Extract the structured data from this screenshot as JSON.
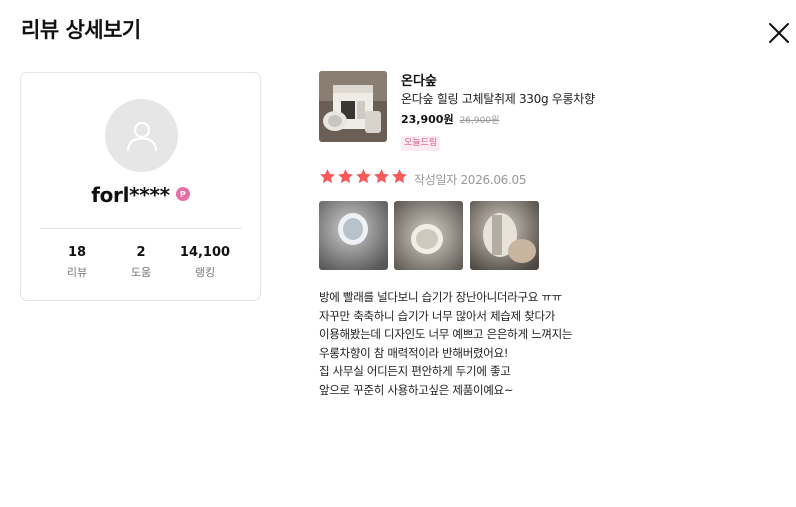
{
  "header": {
    "title": "리뷰 상세보기"
  },
  "icons": {
    "close": "close-icon",
    "avatar": "user-icon",
    "star": "star-icon"
  },
  "colors": {
    "star": "#f35b5b",
    "badge": "#e86ea5",
    "tag_text": "#e35a87",
    "tag_bg": "#fdecf2"
  },
  "profile": {
    "nickname": "forl****",
    "badge": "P",
    "stats": [
      {
        "value": "18",
        "label": "리뷰"
      },
      {
        "value": "2",
        "label": "도움"
      },
      {
        "value": "14,100",
        "label": "랭킹"
      }
    ]
  },
  "product": {
    "brand": "온다숲",
    "name": "온다숲 힐링 고체탈취제 330g 우롱차향",
    "price": "23,900원",
    "original_price": "26,900원",
    "tag": "오늘드림"
  },
  "review": {
    "rating": 5,
    "rating_max": 5,
    "date": "작성일자 2026.06.05",
    "photo_count": 3,
    "lines": [
      "방에 빨래를 널다보니 습기가 장난아니더라구요 ㅠㅠ",
      "자꾸만 축축하니 습기가 너무 많아서 제습제 찾다가",
      "이용해봤는데 디자인도 너무 예쁘고 은은하게 느껴지는",
      "우롱차향이 참 매력적이라 반해버렸어요!",
      "집 사무실 어디든지 편안하게 두기에 좋고",
      "앞으로 꾸준히 사용하고싶은 제품이예요~"
    ]
  }
}
